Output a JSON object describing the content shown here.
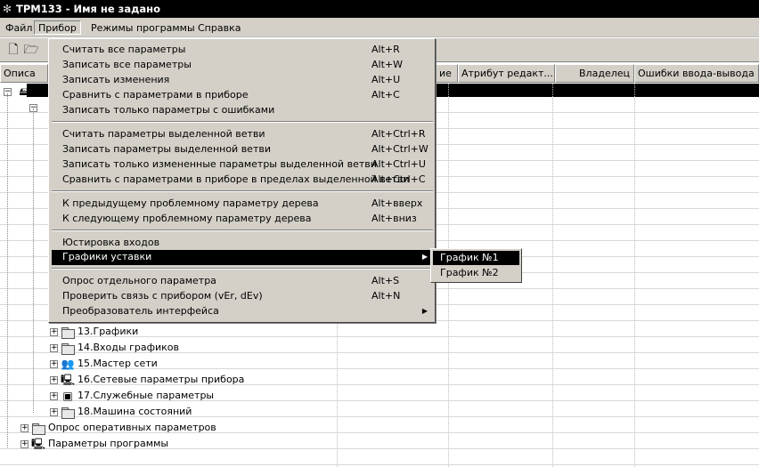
{
  "window": {
    "title": "ТРМ133 - Имя не задано",
    "app_icon": "gear-icon"
  },
  "menubar": [
    {
      "label": "Файл"
    },
    {
      "label": "Прибор"
    },
    {
      "label": "Режимы программы"
    },
    {
      "label": "Справка"
    }
  ],
  "columns": {
    "c0": "Описа",
    "c1": "ие",
    "c2": "Атрибут редакт...",
    "c3": "Владелец",
    "c4": "Ошибки ввода-вывода"
  },
  "tree": {
    "items": [
      {
        "label": "13.Графики",
        "icon": "folder-icon"
      },
      {
        "label": "14.Входы графиков",
        "icon": "folder-icon"
      },
      {
        "label": "15.Мастер сети",
        "icon": "network-icon"
      },
      {
        "label": "16.Сетевые параметры прибора",
        "icon": "computer-icon"
      },
      {
        "label": "17.Служебные параметры",
        "icon": "settings-icon"
      },
      {
        "label": "18.Машина состояний",
        "icon": "folder-icon"
      }
    ],
    "root_items": [
      {
        "label": "Опрос оперативных параметров",
        "icon": "folder-icon"
      },
      {
        "label": "Параметры программы",
        "icon": "computer-icon"
      }
    ]
  },
  "menu": {
    "items": [
      {
        "label": "Считать все параметры",
        "shortcut": "Alt+R"
      },
      {
        "label": "Записать все параметры",
        "shortcut": "Alt+W"
      },
      {
        "label": "Записать изменения",
        "shortcut": "Alt+U"
      },
      {
        "label": "Сравнить с параметрами в приборе",
        "shortcut": "Alt+C"
      },
      {
        "label": "Записать только параметры с ошибками",
        "shortcut": ""
      },
      {
        "label": "Считать параметры выделенной ветви",
        "shortcut": "Alt+Ctrl+R"
      },
      {
        "label": "Записать параметры выделенной ветви",
        "shortcut": "Alt+Ctrl+W"
      },
      {
        "label": "Записать только измененные параметры выделенной ветви",
        "shortcut": "Alt+Ctrl+U"
      },
      {
        "label": "Сравнить с параметрами в приборе в пределах выделенной ветви",
        "shortcut": "Alt+Ctrl+C"
      },
      {
        "label": "К предыдущему проблемному параметру дерева",
        "shortcut": "Alt+вверх"
      },
      {
        "label": "К следующему проблемному параметру дерева",
        "shortcut": "Alt+вниз"
      },
      {
        "label": "Юстировка входов",
        "shortcut": ""
      },
      {
        "label": "Графики уставки",
        "shortcut": ""
      },
      {
        "label": "Опрос отдельного параметра",
        "shortcut": "Alt+S"
      },
      {
        "label": "Проверить связь с прибором (vEr, dEv)",
        "shortcut": "Alt+N"
      },
      {
        "label": "Преобразователь интерфейса",
        "shortcut": ""
      }
    ]
  },
  "submenu": {
    "items": [
      {
        "label": "График №1"
      },
      {
        "label": "График №2"
      }
    ]
  }
}
